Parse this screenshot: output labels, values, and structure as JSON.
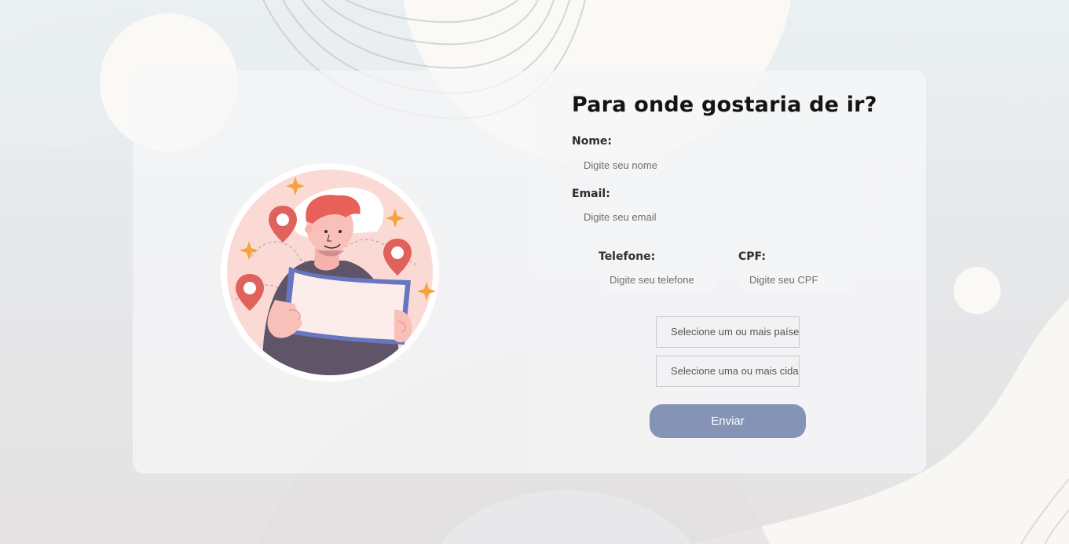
{
  "form": {
    "title": "Para onde gostaria de ir?",
    "nome_label": "Nome:",
    "nome_placeholder": "Digite seu nome",
    "email_label": "Email:",
    "email_placeholder": "Digite seu email",
    "telefone_label": "Telefone:",
    "telefone_placeholder": "Digite seu telefone",
    "cpf_label": "CPF:",
    "cpf_placeholder": "Digite seu CPF",
    "paises_select": "Selecione um ou mais países",
    "cidades_select": "Selecione uma ou mais cidades",
    "submit_label": "Enviar"
  },
  "colors": {
    "submit_button": "#8593b4",
    "pin": "#e0625c",
    "star": "#f5a33a",
    "map_border": "#6776c0",
    "shirt": "#5f5468",
    "hair": "#e8605a"
  },
  "illustration": {
    "icons": [
      "location-pin-icon",
      "sparkle-icon",
      "map-icon"
    ]
  }
}
